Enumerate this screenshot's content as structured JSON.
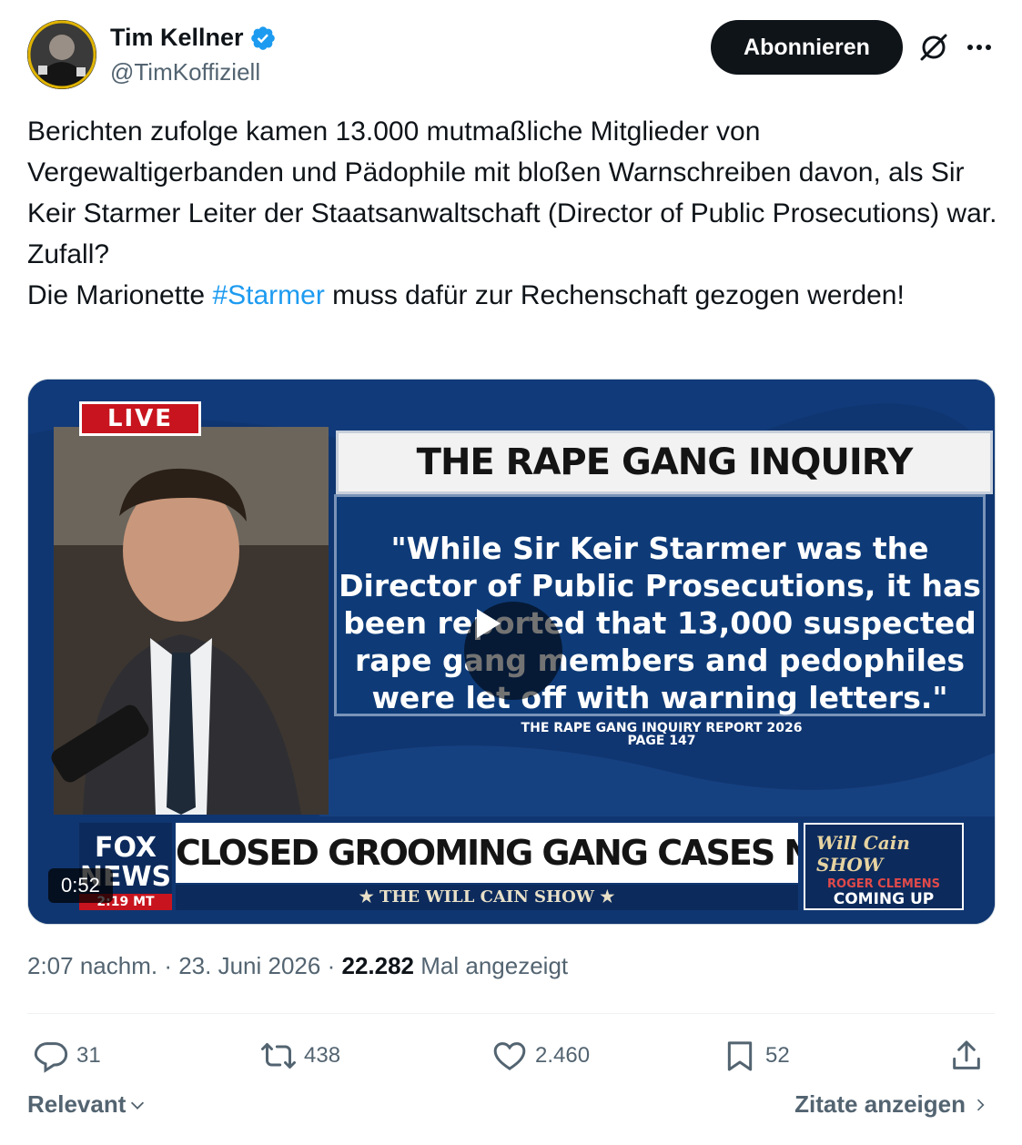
{
  "author": {
    "name": "Tim Kellner",
    "handle": "@TimKoffiziell",
    "verified": true,
    "verified_color": "#1d9bf0"
  },
  "follow_label": "Abonnieren",
  "post": {
    "text_before": "Berichten zufolge kamen 13.000 mutmaßliche Mitglieder von Vergewaltigerbanden und Pädophile mit bloßen Warnschreiben davon, als Sir Keir Starmer Leiter der Staatsanwaltschaft (Director of Public Prosecutions) war.\nZufall?\nDie Marionette ",
    "hashtag": "#Starmer",
    "text_after": " muss dafür zur Rechenschaft gezogen werden!",
    "hashtag_color": "#1d9bf0"
  },
  "video": {
    "duration": "0:52",
    "live_badge": "LIVE",
    "report_title": "THE RAPE GANG INQUIRY REPORT",
    "quote": "\"While Sir Keir Starmer was the Director of Public Prosecutions, it has been reported that 13,000 suspected rape gang members and pedophiles were let off with warning letters.\"",
    "source_line1": "THE RAPE GANG INQUIRY REPORT 2026",
    "source_line2": "PAGE 147",
    "chyron": "CLOSED GROOMING GANG CASES NOW UNDER REVIEW",
    "chyron_sub": "★ THE WILL CAIN SHOW ★",
    "network_logo": "FOX NEWS",
    "network_time": "2:19 MT",
    "show_logo": "Will Cain SHOW",
    "show_guest": "ROGER CLEMENS",
    "show_coming": "COMING UP"
  },
  "meta": {
    "time": "2:07 nachm.",
    "date": "23. Juni 2026",
    "views_count": "22.282",
    "views_label": "Mal angezeigt"
  },
  "actions": {
    "replies": "31",
    "reposts": "438",
    "likes": "2.460",
    "bookmarks": "52"
  },
  "footer": {
    "sort_label": "Relevant",
    "quotes_label": "Zitate anzeigen"
  },
  "colors": {
    "text_primary": "#0f1419",
    "text_secondary": "#536471",
    "accent": "#1d9bf0",
    "button_bg": "#0f1419"
  },
  "icons": [
    "verified-badge-icon",
    "grok-icon",
    "more-icon",
    "play-icon",
    "reply-icon",
    "repost-icon",
    "like-icon",
    "bookmark-icon",
    "share-icon",
    "chevron-down-icon",
    "chevron-right-icon"
  ]
}
